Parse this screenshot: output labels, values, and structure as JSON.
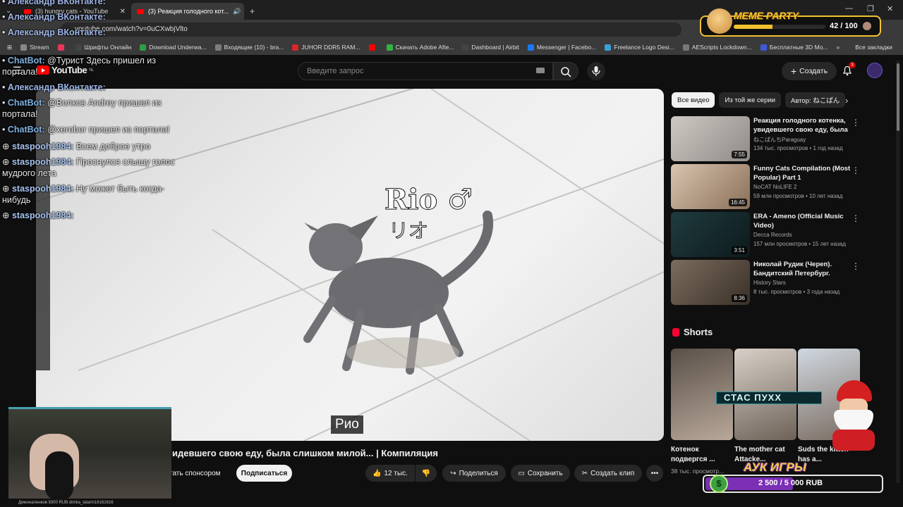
{
  "browser": {
    "tabs": [
      {
        "label": "(3) hungry cats - YouTube",
        "active": false
      },
      {
        "label": "(3) Реакция голодного кот...",
        "active": true
      }
    ],
    "new_tab": "+",
    "url": "youtube.com/watch?v=0uCXwbjVlto",
    "bookmarks": [
      {
        "label": "Stream",
        "color": "#888888"
      },
      {
        "label": "",
        "color": "#e8385a"
      },
      {
        "label": "Шрифты Онлайн",
        "color": "#444444"
      },
      {
        "label": "Download Underwa...",
        "color": "#2f9e44"
      },
      {
        "label": "Входящие (10) - bra...",
        "color": "#7d7d7d"
      },
      {
        "label": "JUHOR DDR5 RAM...",
        "color": "#d62828"
      },
      {
        "label": "",
        "color": "#ff0000"
      },
      {
        "label": "Скачать Adobe Afte...",
        "color": "#2fb344"
      },
      {
        "label": "Dashboard | Airbit",
        "color": "#444444"
      },
      {
        "label": "Messenger | Facebo...",
        "color": "#1877f2"
      },
      {
        "label": "Freelance Logo Desi...",
        "color": "#3aa0d8"
      },
      {
        "label": "AEScripts Lockdown...",
        "color": "#777777"
      },
      {
        "label": "Бесплатные 3D Мо...",
        "color": "#3b5bdb"
      }
    ],
    "more_bookmarks": "»",
    "all_bookmarks": "Все закладки"
  },
  "youtube": {
    "logo_text": "YouTube",
    "logo_region": "NL",
    "search_placeholder": "Введите запрос",
    "create_label": "Создать",
    "notifications": "3"
  },
  "video": {
    "overlay_name": "Rio ♂",
    "overlay_jp": "リオ",
    "subtitle": "Рио",
    "title_visible": "идевшего свою еду, была слишком милой... | Компиляция",
    "sponsor_label": "тать спонсором",
    "subscribe_label": "Подписаться",
    "likes": "12 тыс.",
    "share_label": "Поделиться",
    "save_label": "Сохранить",
    "clip_label": "Создать клип",
    "more": "•••"
  },
  "chips": [
    "Все видео",
    "Из той же серии",
    "Автор: ねこぱん"
  ],
  "recommendations": [
    {
      "title": "Реакция голодного котенка, увидевшего свою еду, была ...",
      "channel": "ねこぱんちParaguay",
      "verified": true,
      "meta": "134 тыс. просмотров • 1 год назад",
      "duration": "7:55",
      "thumb": [
        "#cfc9c4",
        "#8f8a86"
      ]
    },
    {
      "title": "Funny Cats Compilation (Most Popular) Part 1",
      "channel": "NoCAT NoLIFE 2",
      "verified": false,
      "meta": "59 млн просмотров • 10 лет назад",
      "duration": "16:45",
      "thumb": [
        "#d8c5b0",
        "#8a6f58"
      ]
    },
    {
      "title": "ERA - Ameno (Official Music Video)",
      "channel": "Decca Records",
      "verified": false,
      "meta": "157 млн просмотров • 15 лет назад",
      "duration": "3:51",
      "thumb": [
        "#1f3b3f",
        "#0d1a1c"
      ]
    },
    {
      "title": "Николай Рудик (Череп). Бандитский Петербург. Баро...",
      "channel": "History Stars",
      "verified": false,
      "meta": "8 тыс. просмотров • 3 года назад",
      "duration": "8:36",
      "thumb": [
        "#7b6d5e",
        "#3a3028"
      ]
    }
  ],
  "shorts": {
    "heading": "Shorts",
    "items": [
      {
        "title": "Котенок подвергся ...",
        "meta": "38 тыс. просмотр...",
        "thumb": [
          "#5a5048",
          "#b8a89a"
        ]
      },
      {
        "title": "The mother cat Attacke...",
        "meta": "",
        "thumb": [
          "#d8d0c8",
          "#6e6258"
        ]
      },
      {
        "title": "Suds the kitten has a...",
        "meta": "",
        "thumb": [
          "#cfd8e0",
          "#7a6a60"
        ]
      }
    ]
  },
  "overlays": {
    "chat": [
      {
        "user": "Александр ВКонтакте:",
        "text": "",
        "style": "u1"
      },
      {
        "user": "Александр ВКонтакте:",
        "text": "",
        "style": "u1"
      },
      {
        "user": "Александр ВКонтакте:",
        "text": "",
        "style": "u1"
      },
      {
        "user": "ChatBot:",
        "text": " @Турист Здесь пришел из портала!",
        "style": "u2"
      },
      {
        "user": "Александр ВКонтакте:",
        "text": "",
        "style": "u1"
      },
      {
        "user": "ChatBot:",
        "text": " @Волков Andrey пришел из портала!",
        "style": "u2"
      },
      {
        "user": "ChatBot:",
        "text": " @xerobor пришел из портала!",
        "style": "u2"
      },
      {
        "user": "staspooh1984:",
        "text": " Всем доброе утро",
        "style": "u3"
      },
      {
        "user": "staspooh1984:",
        "text": " Проснулся слышу голос мудрого лета",
        "style": "u3"
      },
      {
        "user": "staspooh1984:",
        "text": " Ну может быть когда-нибудь",
        "style": "u3"
      },
      {
        "user": "staspooh1984:",
        "text": "",
        "style": "u3"
      }
    ],
    "meme_party": {
      "title": "MEME PARTY",
      "count": "42 / 100",
      "progress": 0.42
    },
    "auction": {
      "title": "АУК ИГРЫ",
      "amount": "2 500 / 5 000 RUB",
      "progress": 0.5,
      "coin": "$"
    },
    "stas": "СТАС ПУХХ",
    "ticker": "Димоналенков 9300 RUB   dimka_tatarin16161616"
  }
}
